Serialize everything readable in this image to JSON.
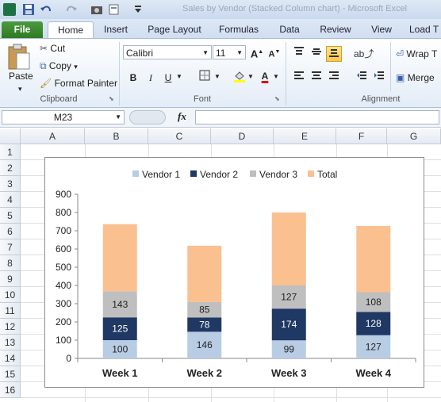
{
  "window": {
    "title": "Sales by Vendor (Stacked Column chart) - Microsoft Excel",
    "quick_access": [
      "save-icon",
      "undo-icon",
      "redo-icon",
      "camera-icon",
      "customize-icon"
    ]
  },
  "tabs": [
    "File",
    "Home",
    "Insert",
    "Page Layout",
    "Formulas",
    "Data",
    "Review",
    "View",
    "Load T"
  ],
  "ribbon": {
    "clipboard": {
      "paste": "Paste",
      "cut": "Cut",
      "copy": "Copy",
      "format_painter": "Format Painter",
      "label": "Clipboard"
    },
    "font": {
      "name": "Calibri",
      "size": "11",
      "bold": "B",
      "italic": "I",
      "underline": "U",
      "label": "Font"
    },
    "alignment": {
      "wrap": "Wrap T",
      "merge": "Merge",
      "label": "Alignment"
    }
  },
  "formula_bar": {
    "name_box": "M23",
    "fx": "fx",
    "value": ""
  },
  "grid": {
    "columns": [
      "A",
      "B",
      "C",
      "D",
      "E",
      "F",
      "G"
    ],
    "rows": [
      "1",
      "2",
      "3",
      "4",
      "5",
      "6",
      "7",
      "8",
      "9",
      "10",
      "11",
      "12",
      "13",
      "14",
      "15",
      "16"
    ]
  },
  "chart_data": {
    "type": "bar",
    "stacked": true,
    "categories": [
      "Week 1",
      "Week 2",
      "Week 3",
      "Week 4"
    ],
    "series": [
      {
        "name": "Vendor 1",
        "values": [
          100,
          146,
          99,
          127
        ],
        "color": "#b8cce4"
      },
      {
        "name": "Vendor 2",
        "values": [
          125,
          78,
          174,
          128
        ],
        "color": "#1f3864"
      },
      {
        "name": "Vendor 3",
        "values": [
          143,
          85,
          127,
          108
        ],
        "color": "#bfbfbf"
      },
      {
        "name": "Total",
        "values": [
          368,
          309,
          400,
          363
        ],
        "color": "#fac090"
      }
    ],
    "ylim": [
      0,
      900
    ],
    "yticks": [
      0,
      100,
      200,
      300,
      400,
      500,
      600,
      700,
      800,
      900
    ],
    "legend": "top",
    "grid": false
  }
}
